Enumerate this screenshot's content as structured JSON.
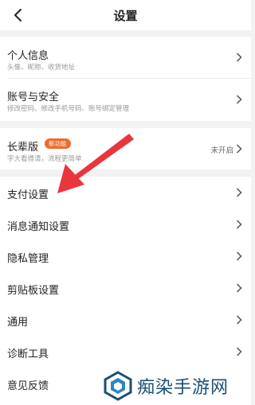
{
  "header": {
    "title": "设置",
    "back_icon": "chevron-left-icon"
  },
  "groups": [
    {
      "items": [
        {
          "label": "个人信息",
          "subtitle": "头像、昵称、收货地址"
        },
        {
          "label": "账号与安全",
          "subtitle": "修改密码、修改手机号码、账号绑定管理"
        }
      ]
    },
    {
      "items": [
        {
          "label": "长辈版",
          "badge": "新功能",
          "subtitle": "字大看得清，流程更简单",
          "value": "未开启"
        }
      ]
    },
    {
      "items": [
        {
          "label": "支付设置"
        },
        {
          "label": "消息通知设置"
        },
        {
          "label": "隐私管理"
        },
        {
          "label": "剪贴板设置"
        },
        {
          "label": "通用"
        },
        {
          "label": "诊断工具"
        },
        {
          "label": "意见反馈"
        }
      ]
    }
  ],
  "annotation": {
    "arrow_color": "#e8363c"
  },
  "watermark": {
    "text": "痴染手游网",
    "color": "#1a4f74"
  }
}
